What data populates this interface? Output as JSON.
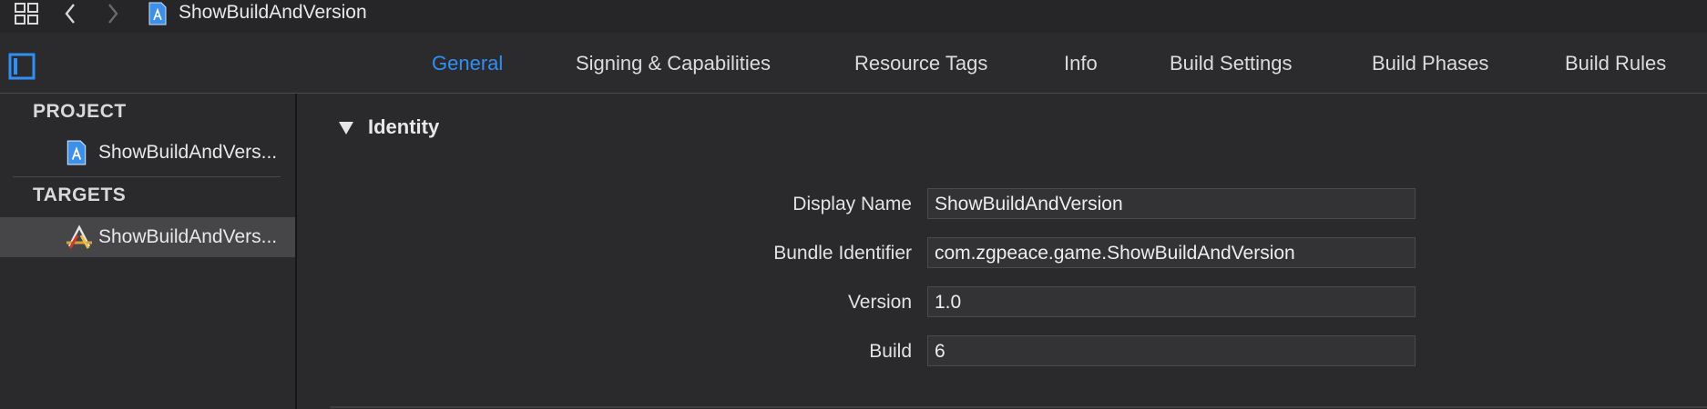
{
  "toolbar": {
    "title": "ShowBuildAndVersion"
  },
  "tabs": [
    {
      "label": "General",
      "active": true
    },
    {
      "label": "Signing & Capabilities",
      "active": false
    },
    {
      "label": "Resource Tags",
      "active": false
    },
    {
      "label": "Info",
      "active": false
    },
    {
      "label": "Build Settings",
      "active": false
    },
    {
      "label": "Build Phases",
      "active": false
    },
    {
      "label": "Build Rules",
      "active": false
    }
  ],
  "sidebar": {
    "project_header": "PROJECT",
    "project_item": "ShowBuildAndVers...",
    "targets_header": "TARGETS",
    "target_item": "ShowBuildAndVers..."
  },
  "identity": {
    "title": "Identity",
    "fields": [
      {
        "label": "Display Name",
        "value": "ShowBuildAndVersion"
      },
      {
        "label": "Bundle Identifier",
        "value": "com.zgpeace.game.ShowBuildAndVersion"
      },
      {
        "label": "Version",
        "value": "1.0"
      },
      {
        "label": "Build",
        "value": "6"
      }
    ]
  },
  "colors": {
    "accent": "#2f8ff5",
    "background": "#2a2a2d",
    "selected_row": "#464649"
  }
}
